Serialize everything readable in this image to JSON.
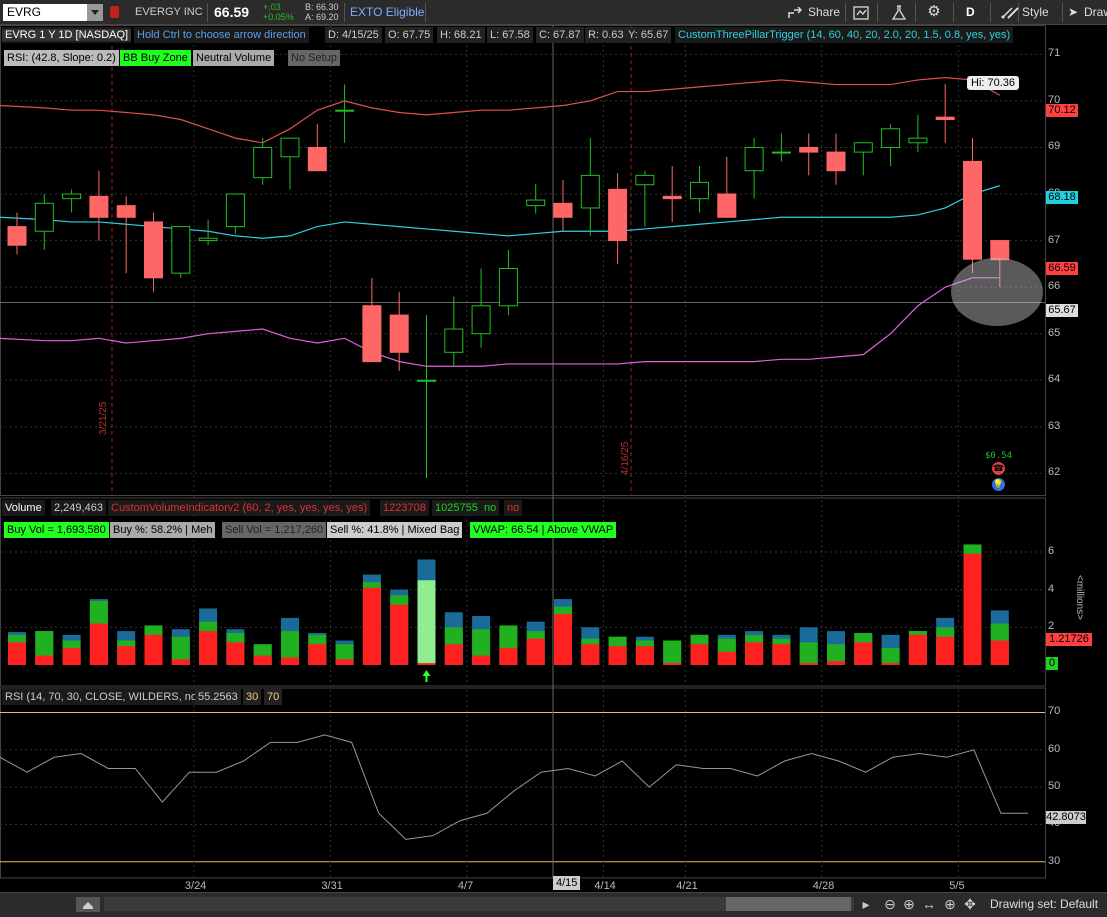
{
  "topbar": {
    "symbol": "EVRG",
    "company": "EVERGY INC",
    "last": "66.59",
    "change": "+.03",
    "change_pct": "+0.05%",
    "bid": "B: 66.30",
    "ask": "A: 69.20",
    "exto": "EXTO Eligible",
    "share": "Share",
    "timeframe": "D",
    "style": "Style",
    "drawings": "Draw"
  },
  "header": {
    "title": "EVRG 1 Y 1D [NASDAQ]",
    "hint": "Hold Ctrl to choose arrow direction",
    "date": "D: 4/15/25",
    "open": "O: 67.75",
    "high": "H: 68.21",
    "low": "L: 67.58",
    "close": "C: 67.87",
    "range": "R: 0.63",
    "y": "Y: 65.67",
    "study": "CustomThreePillarTrigger (14, 60, 40, 20, 2.0, 20, 1.5, 0.8, yes, yes)"
  },
  "price_pills": {
    "rsi": "RSI: (42.8, Slope: 0.2)",
    "bb": "BB Buy Zone",
    "nv": "Neutral Volume",
    "setup": "No Setup"
  },
  "price_tags": {
    "hi": "Hi: 70.36",
    "upper": "70.12",
    "mid": "68.18",
    "last": "66.59",
    "cursor": "65.67",
    "dividend": "$0.54"
  },
  "price_axis": [
    "71",
    "70",
    "69",
    "68",
    "67",
    "66",
    "65",
    "64",
    "63",
    "62"
  ],
  "vertical_dates": [
    "3/21/25",
    "4/16/25"
  ],
  "volume_header": {
    "label": "Volume",
    "value": "2,249,463",
    "study": "CustomVolumeIndicatorv2 (60, 2, yes, yes, yes, yes)",
    "v1": "1223708",
    "v2": "1025755",
    "no1": "no",
    "no2": "no"
  },
  "volume_pills": {
    "buy_vol": "Buy Vol = 1,693,580",
    "buy_pct": "Buy %: 58.2% | Meh",
    "sell_vol": "Sell Vol = 1,217,260",
    "sell_pct": "Sell %: 41.8% | Mixed Bag",
    "vwap": "VWAP: 66.54 | Above VWAP"
  },
  "volume_axis": [
    "6",
    "4",
    "2",
    "0"
  ],
  "volume_unit": "<millions>",
  "volume_tag": "1.21726",
  "rsi_header": {
    "label": "RSI (14, 70, 30, CLOSE, WILDERS, no)",
    "value": "55.2563",
    "lo": "30",
    "hi": "70"
  },
  "rsi_axis": [
    "70",
    "60",
    "50",
    "40",
    "30"
  ],
  "rsi_tag": "42.8073",
  "date_axis": [
    "3/24",
    "3/31",
    "4/7",
    "4/14",
    "4/21",
    "4/28",
    "5/5"
  ],
  "date_cursor": "4/15",
  "bottombar": {
    "drawing_set": "Drawing set: Default"
  },
  "chart_data": {
    "type": "candlestick",
    "dates": [
      "3/19",
      "3/20",
      "3/21",
      "3/24",
      "3/25",
      "3/26",
      "3/27",
      "3/28",
      "3/31",
      "4/1",
      "4/2",
      "4/3",
      "4/4",
      "4/7",
      "4/8",
      "4/9",
      "4/10",
      "4/11",
      "4/14",
      "4/15",
      "4/16",
      "4/17",
      "4/21",
      "4/22",
      "4/23",
      "4/24",
      "4/25",
      "4/28",
      "4/29",
      "4/30",
      "5/1",
      "5/2",
      "5/5",
      "5/6",
      "5/7",
      "5/8",
      "5/9"
    ],
    "open": [
      67.3,
      67.2,
      67.9,
      67.95,
      67.75,
      67.4,
      66.3,
      67.0,
      67.3,
      68.35,
      68.8,
      69.0,
      69.8,
      65.6,
      65.4,
      64.0,
      64.6,
      65.0,
      65.6,
      67.75,
      67.8,
      67.7,
      68.1,
      68.2,
      67.95,
      67.9,
      68.0,
      68.5,
      68.9,
      69.0,
      68.9,
      68.9,
      69.0,
      69.1,
      69.65,
      68.7,
      67.0
    ],
    "high": [
      67.6,
      68.0,
      68.1,
      68.5,
      67.95,
      67.6,
      67.1,
      67.45,
      68.0,
      69.2,
      69.0,
      69.5,
      70.35,
      66.2,
      65.9,
      65.4,
      65.8,
      66.4,
      66.8,
      68.21,
      68.3,
      69.2,
      68.45,
      68.5,
      68.6,
      68.6,
      68.8,
      69.2,
      69.3,
      69.3,
      69.3,
      69.1,
      69.5,
      69.7,
      70.36,
      69.2,
      67.0
    ],
    "low": [
      66.7,
      66.8,
      67.6,
      67.0,
      66.3,
      65.9,
      66.2,
      66.9,
      67.15,
      68.2,
      68.1,
      68.5,
      69.1,
      64.4,
      64.2,
      61.9,
      64.3,
      64.7,
      65.4,
      67.58,
      67.2,
      67.1,
      66.5,
      67.3,
      67.4,
      67.6,
      67.8,
      67.9,
      68.7,
      68.4,
      68.2,
      68.4,
      68.6,
      68.9,
      69.1,
      66.3,
      66.0
    ],
    "close": [
      66.9,
      67.8,
      68.0,
      67.5,
      67.5,
      66.2,
      67.3,
      67.05,
      68.0,
      69.0,
      69.2,
      68.5,
      69.8,
      64.4,
      64.6,
      64.0,
      65.1,
      65.6,
      66.4,
      67.87,
      67.5,
      68.4,
      67.0,
      68.4,
      67.9,
      68.25,
      67.5,
      69.0,
      68.9,
      68.9,
      68.5,
      69.1,
      69.4,
      69.2,
      69.6,
      66.6,
      66.59
    ],
    "bb_upper": [
      69.9,
      69.85,
      69.8,
      69.8,
      69.75,
      69.7,
      69.6,
      69.4,
      69.2,
      69.1,
      69.4,
      69.8,
      70.0,
      69.85,
      69.75,
      69.7,
      69.75,
      69.8,
      69.8,
      69.85,
      69.9,
      70.0,
      70.2,
      70.2,
      70.25,
      70.3,
      70.35,
      70.4,
      70.45,
      70.4,
      70.35,
      70.35,
      70.35,
      70.45,
      70.5,
      70.45,
      70.12
    ],
    "bb_mid": [
      67.5,
      67.45,
      67.4,
      67.4,
      67.35,
      67.3,
      67.25,
      67.2,
      67.1,
      67.05,
      67.1,
      67.3,
      67.4,
      67.35,
      67.3,
      67.25,
      67.2,
      67.15,
      67.1,
      67.15,
      67.2,
      67.2,
      67.2,
      67.25,
      67.3,
      67.35,
      67.4,
      67.45,
      67.5,
      67.5,
      67.5,
      67.5,
      67.5,
      67.55,
      67.7,
      68.0,
      68.18
    ],
    "bb_lower": [
      64.9,
      64.85,
      64.85,
      64.9,
      64.8,
      64.85,
      64.9,
      65.0,
      65.05,
      65.1,
      64.9,
      64.8,
      64.9,
      64.6,
      64.4,
      64.3,
      64.3,
      64.3,
      64.35,
      64.35,
      64.35,
      64.35,
      64.35,
      64.4,
      64.4,
      64.4,
      64.4,
      64.4,
      64.45,
      64.45,
      64.5,
      64.55,
      65.0,
      65.6,
      66.0,
      66.2,
      66.2
    ],
    "vol_buy": [
      0.4,
      1.3,
      0.4,
      1.2,
      0.3,
      0.5,
      1.2,
      0.5,
      0.5,
      0.6,
      1.4,
      0.5,
      0.8,
      0.3,
      0.5,
      4.4,
      0.9,
      1.4,
      1.2,
      0.4,
      0.4,
      0.3,
      0.5,
      0.3,
      1.2,
      0.5,
      0.7,
      0.4,
      0.3,
      1.1,
      0.9,
      0.5,
      0.8,
      0.2,
      0.5,
      0.5,
      0.9
    ],
    "vol_sell": [
      1.2,
      0.5,
      0.9,
      2.2,
      1.0,
      1.6,
      0.3,
      1.8,
      1.2,
      0.5,
      0.4,
      1.1,
      0.3,
      4.1,
      3.2,
      0.1,
      1.1,
      0.5,
      0.9,
      1.4,
      2.7,
      1.1,
      1.0,
      1.0,
      0.1,
      1.1,
      0.7,
      1.2,
      1.1,
      0.1,
      0.2,
      1.2,
      0.1,
      1.6,
      1.5,
      5.9,
      1.3
    ],
    "vol_total": [
      1.75,
      1.8,
      1.6,
      3.5,
      1.8,
      2.0,
      1.9,
      3.0,
      1.9,
      1.1,
      2.5,
      1.7,
      1.3,
      4.8,
      4.0,
      5.6,
      2.8,
      2.6,
      2.0,
      2.3,
      3.5,
      2.0,
      1.5,
      1.5,
      1.3,
      1.6,
      1.6,
      1.8,
      1.6,
      2.0,
      1.8,
      1.6,
      1.6,
      1.8,
      2.5,
      6.2,
      2.9
    ],
    "vol_highlight_index": 15,
    "rsi": [
      58,
      54,
      58,
      59,
      55,
      55,
      46,
      54,
      54,
      57,
      62,
      62,
      64,
      62,
      43,
      36,
      37,
      41,
      43,
      49,
      54,
      55,
      53,
      57,
      50,
      56,
      55,
      55,
      53,
      57,
      59,
      57,
      54,
      58,
      59,
      58,
      60,
      43,
      43
    ],
    "price_ylim": [
      61.6,
      71.2
    ],
    "vol_ylim": [
      0,
      6.9
    ],
    "rsi_ylim": [
      27,
      72
    ]
  }
}
